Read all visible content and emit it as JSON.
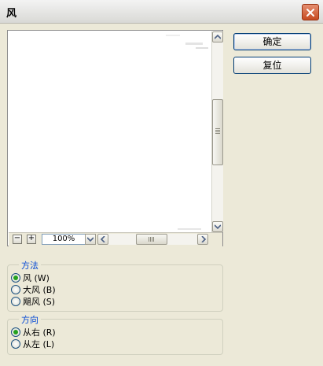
{
  "window": {
    "title": "风"
  },
  "buttons": {
    "ok_label": "确定",
    "reset_label": "复位"
  },
  "preview": {
    "zoom_level": "100%",
    "zoom_out_label": "−",
    "zoom_in_label": "+"
  },
  "method_group": {
    "title": "方法",
    "options": [
      {
        "label": "风 (W)",
        "checked": true
      },
      {
        "label": "大风 (B)",
        "checked": false
      },
      {
        "label": "飓风 (S)",
        "checked": false
      }
    ]
  },
  "direction_group": {
    "title": "方向",
    "options": [
      {
        "label": "从右 (R)",
        "checked": true
      },
      {
        "label": "从左 (L)",
        "checked": false
      }
    ]
  },
  "colors": {
    "accent": "#0046d5",
    "radio_check": "#23a11e",
    "close_button": "#c64b21"
  },
  "icons": [
    "close-icon",
    "scroll-up-arrow-icon",
    "scroll-down-arrow-icon",
    "scroll-left-arrow-icon",
    "scroll-right-arrow-icon",
    "dropdown-arrow-icon"
  ]
}
